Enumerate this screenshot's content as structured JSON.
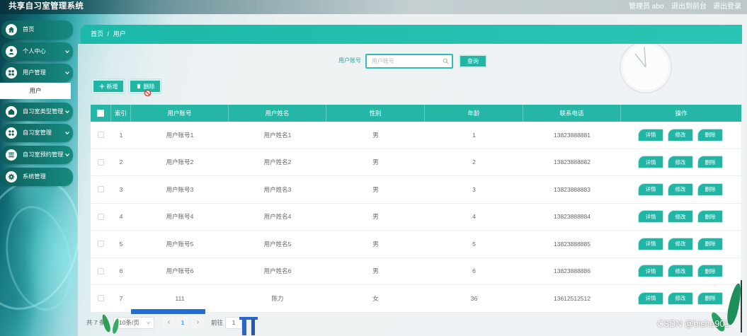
{
  "app": {
    "title": "共享自习室管理系统"
  },
  "header": {
    "user": "管理员 abo",
    "to_front": "退出到前台",
    "logout": "退出登录"
  },
  "sidebar": {
    "items": [
      {
        "label": "首页",
        "icon": "home-icon"
      },
      {
        "label": "个人中心",
        "icon": "user-icon"
      },
      {
        "label": "用户管理",
        "icon": "grid-icon",
        "expanded": true,
        "children": [
          {
            "label": "用户",
            "active": true
          }
        ]
      },
      {
        "label": "自习室类型管理",
        "icon": "house-icon"
      },
      {
        "label": "自习室管理",
        "icon": "grid-icon"
      },
      {
        "label": "自习室预约管理",
        "icon": "list-icon"
      },
      {
        "label": "系统管理",
        "icon": "gear-icon"
      }
    ]
  },
  "breadcrumb": {
    "home": "首页",
    "separator": "/",
    "current": "用户"
  },
  "search": {
    "label": "用户账号",
    "placeholder": "用户账号",
    "value": "",
    "button": "查询"
  },
  "toolbar": {
    "add": "新增",
    "delete": "删除"
  },
  "table": {
    "columns": {
      "index": "索引",
      "account": "用户账号",
      "name": "用户姓名",
      "gender": "性别",
      "age": "年龄",
      "phone": "联系电话",
      "actions": "操作"
    },
    "rows": [
      {
        "index": "1",
        "account": "用户账号1",
        "name": "用户姓名1",
        "gender": "男",
        "age": "1",
        "phone": "13823888881"
      },
      {
        "index": "2",
        "account": "用户账号2",
        "name": "用户姓名2",
        "gender": "男",
        "age": "2",
        "phone": "13823888882"
      },
      {
        "index": "3",
        "account": "用户账号3",
        "name": "用户姓名3",
        "gender": "男",
        "age": "3",
        "phone": "13823888883"
      },
      {
        "index": "4",
        "account": "用户账号4",
        "name": "用户姓名4",
        "gender": "男",
        "age": "4",
        "phone": "13823888884"
      },
      {
        "index": "5",
        "account": "用户账号5",
        "name": "用户姓名5",
        "gender": "男",
        "age": "5",
        "phone": "13823888885"
      },
      {
        "index": "6",
        "account": "用户账号6",
        "name": "用户姓名6",
        "gender": "男",
        "age": "6",
        "phone": "13823888886"
      },
      {
        "index": "7",
        "account": "111",
        "name": "陈力",
        "gender": "女",
        "age": "36",
        "phone": "13612512512"
      }
    ],
    "row_actions": {
      "detail": "详情",
      "edit": "修改",
      "delete": "删除"
    }
  },
  "pagination": {
    "total": "共 7 条",
    "page_size": "10条/页",
    "current_page": "1",
    "goto_label": "前往",
    "goto_value": "1"
  },
  "watermark": "CSDN @bishe901",
  "colors": {
    "primary": "#22b5a6",
    "sidebar": "#137a71",
    "active_page": "#409eff",
    "cursor_warning": "#e53935"
  }
}
